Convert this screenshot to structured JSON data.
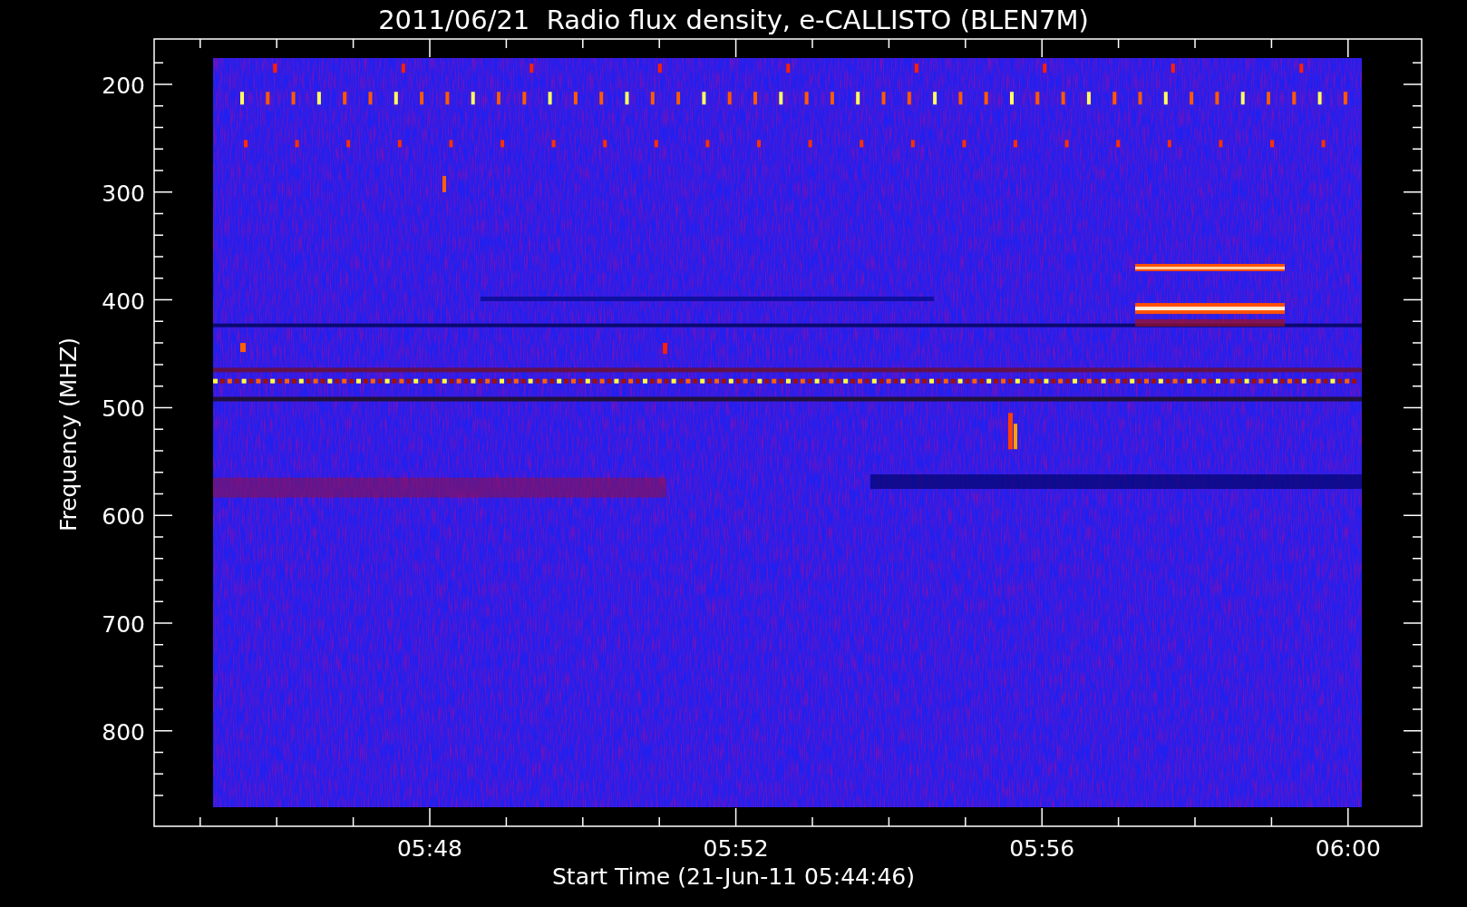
{
  "title": "2011/06/21  Radio flux density, e-CALLISTO (BLEN7M)",
  "y_axis": {
    "label": "Frequency (MHZ)",
    "ticks": [
      "200",
      "300",
      "400",
      "500",
      "600",
      "700",
      "800"
    ]
  },
  "x_axis": {
    "label": "Start Time (21-Jun-11 05:44:46)",
    "ticks": [
      "05:48",
      "05:52",
      "05:56",
      "06:00"
    ]
  }
}
